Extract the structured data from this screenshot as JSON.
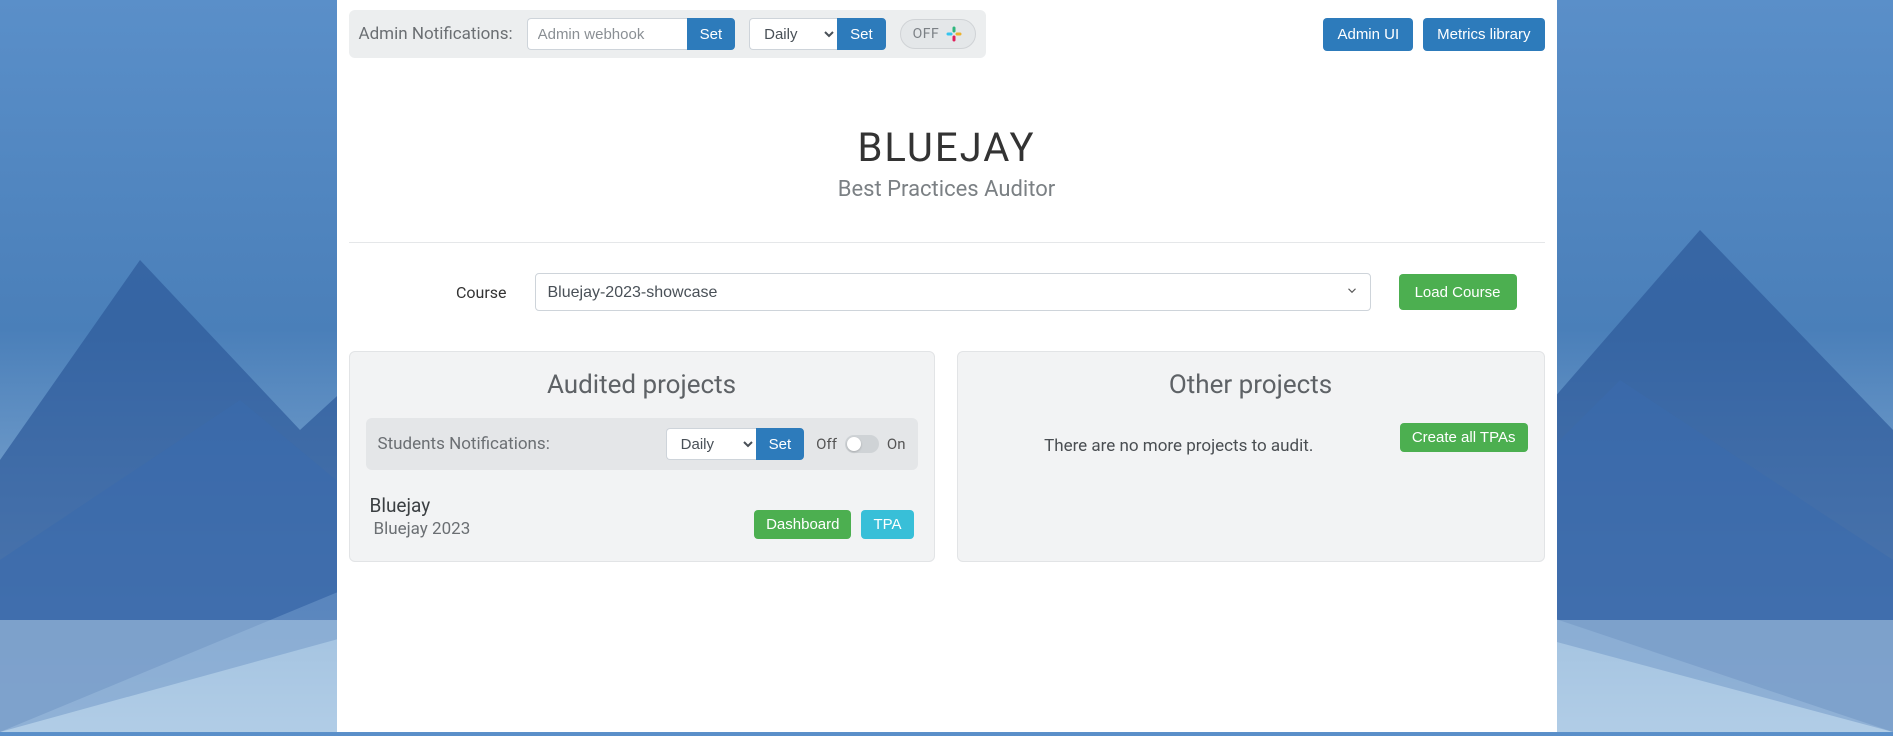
{
  "topbar": {
    "admin_notifications_label": "Admin Notifications:",
    "webhook_placeholder": "Admin webhook",
    "set_label": "Set",
    "frequency_value": "Daily",
    "toggle_off_text": "OFF",
    "admin_ui_label": "Admin UI",
    "metrics_library_label": "Metrics library"
  },
  "brand": {
    "title": "BLUEJAY",
    "subtitle": "Best Practices Auditor"
  },
  "course": {
    "label": "Course",
    "selected": "Bluejay-2023-showcase",
    "load_label": "Load Course"
  },
  "panels": {
    "audited": {
      "title": "Audited projects",
      "students_notifications_label": "Students Notifications:",
      "frequency_value": "Daily",
      "set_label": "Set",
      "switch_off": "Off",
      "switch_on": "On",
      "projects": [
        {
          "name": "Bluejay",
          "sub": "Bluejay 2023",
          "dashboard_label": "Dashboard",
          "tpa_label": "TPA"
        }
      ]
    },
    "other": {
      "title": "Other projects",
      "empty_text": "There are no more projects to audit.",
      "create_all_label": "Create all TPAs"
    }
  }
}
